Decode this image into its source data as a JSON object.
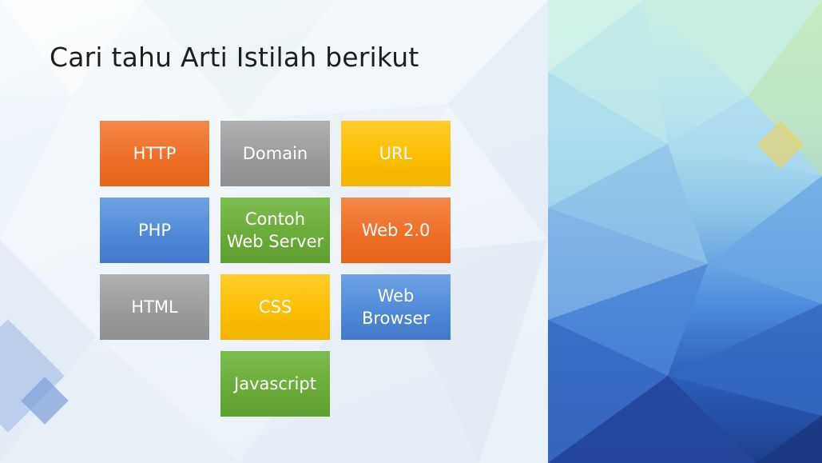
{
  "title": "Cari tahu Arti Istilah berikut",
  "tiles": [
    {
      "label": "HTTP",
      "color": "#ee6d24"
    },
    {
      "label": "Domain",
      "color": "#9a9a9a"
    },
    {
      "label": "URL",
      "color": "#fbbd00"
    },
    {
      "label": "PHP",
      "color": "#4d88d6"
    },
    {
      "label": "Contoh\nWeb Server",
      "color": "#68ab38"
    },
    {
      "label": "Web 2.0",
      "color": "#ee6d24"
    },
    {
      "label": "HTML",
      "color": "#9a9a9a"
    },
    {
      "label": "CSS",
      "color": "#fbbd00"
    },
    {
      "label": "Web\nBrowser",
      "color": "#4d88d6"
    },
    {
      "label": "Javascript",
      "color": "#68ab38"
    }
  ]
}
